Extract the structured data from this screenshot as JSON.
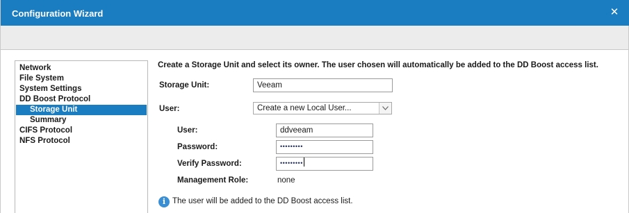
{
  "window": {
    "title": "Configuration Wizard",
    "close_glyph": "✕"
  },
  "nav": {
    "items": [
      {
        "label": "Network",
        "selected": false
      },
      {
        "label": "File System",
        "selected": false
      },
      {
        "label": "System Settings",
        "selected": false
      },
      {
        "label": "DD Boost Protocol",
        "selected": false
      },
      {
        "label": "Storage Unit",
        "selected": true
      },
      {
        "label": "Summary",
        "selected": false
      },
      {
        "label": "CIFS Protocol",
        "selected": false
      },
      {
        "label": "NFS Protocol",
        "selected": false
      }
    ]
  },
  "form": {
    "intro": "Create a Storage Unit and select its owner. The user chosen will automatically be added to the DD Boost access list.",
    "storage_unit_label": "Storage Unit:",
    "storage_unit_value": "Veeam",
    "user_select_label": "User:",
    "user_select_value": "Create a new Local User...",
    "new_user": {
      "user_label": "User:",
      "user_value": "ddveeam",
      "password_label": "Password:",
      "password_value": "•••••••••",
      "verify_label": "Verify Password:",
      "verify_value": "•••••••••",
      "role_label": "Management Role:",
      "role_value": "none"
    },
    "info_glyph": "i",
    "info_text": "The user will be added to the DD Boost access list."
  },
  "colors": {
    "titlebar": "#1a7cc1",
    "selected_nav": "#1a7cc1",
    "info_icon": "#3a8fd4"
  }
}
